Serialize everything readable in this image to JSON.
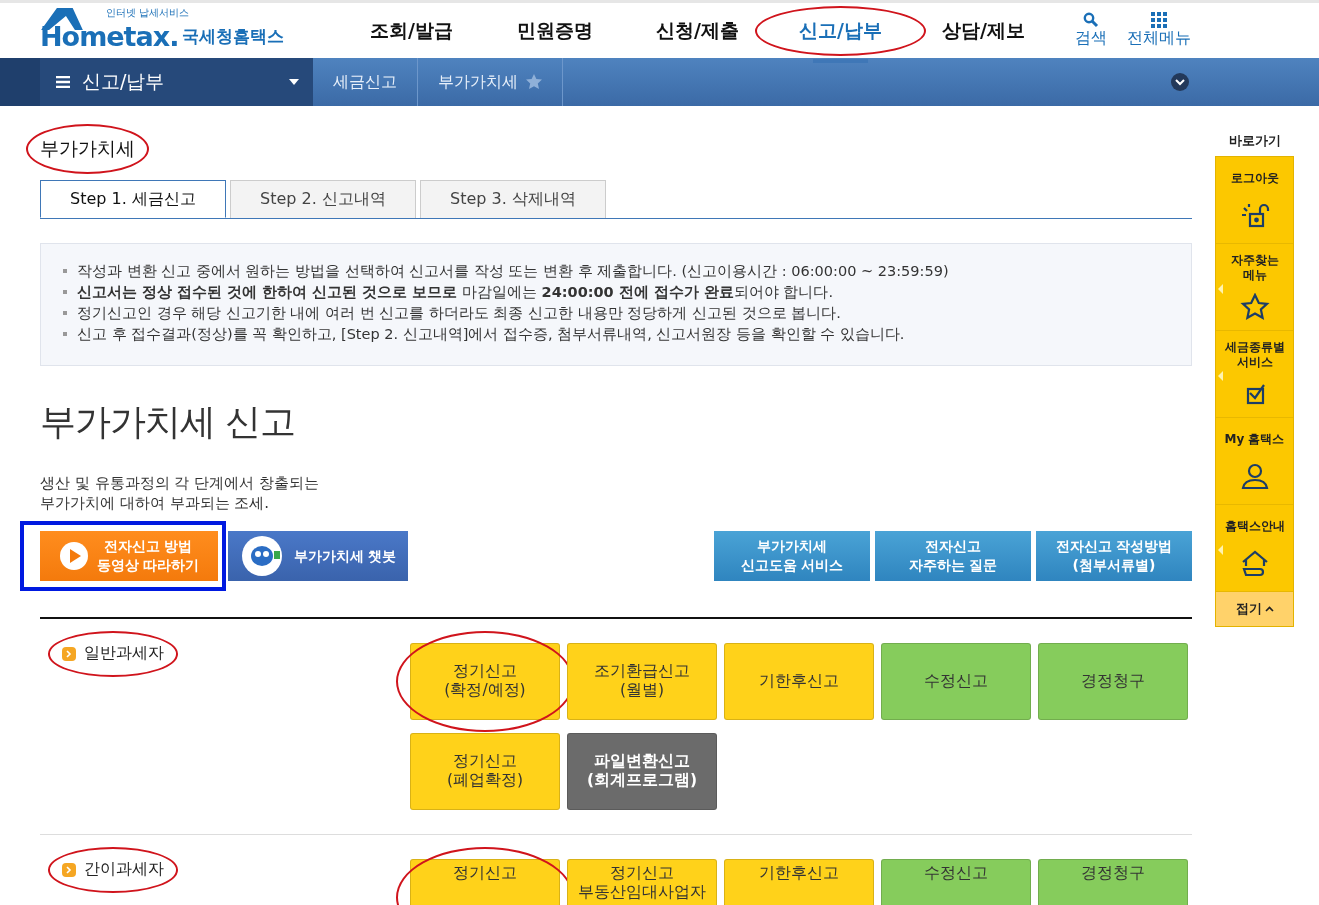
{
  "header": {
    "logo": {
      "tagline": "인터넷 납세서비스",
      "brand": "Hometax.",
      "name": "국세청홈택스"
    },
    "menu": [
      {
        "label": "조회/발급",
        "selected": false,
        "circled": false
      },
      {
        "label": "민원증명",
        "selected": false,
        "circled": false
      },
      {
        "label": "신청/제출",
        "selected": false,
        "circled": false
      },
      {
        "label": "신고/납부",
        "selected": true,
        "circled": true
      },
      {
        "label": "상담/제보",
        "selected": false,
        "circled": false
      }
    ],
    "tools": [
      {
        "label": "검색",
        "kind": "search"
      },
      {
        "label": "전체메뉴",
        "kind": "grid"
      }
    ]
  },
  "breadcrumb": {
    "menu_label": "신고/납부",
    "items": [
      "세금신고",
      "부가가치세"
    ],
    "favorite": false
  },
  "page_title": {
    "text": "부가가치세",
    "circled": true
  },
  "tabs": [
    {
      "label": "Step 1. 세금신고",
      "selected": true
    },
    {
      "label": "Step 2. 신고내역",
      "selected": false
    },
    {
      "label": "Step 3. 삭제내역",
      "selected": false
    }
  ],
  "notices": [
    "작성과 변환 신고 중에서 원하는 방법을 선택하여 신고서를 작성 또는 변환 후 제출합니다. (신고이용시간 : 06:00:00 ~ 23:59:59)",
    "**신고서는 정상 접수된 것에 한하여 신고된 것으로 보므로** 마감일에는 **24:00:00 전에 접수가 완료**되어야 합니다.",
    "정기신고인 경우 해당 신고기한 내에 여러 번 신고를 하더라도 최종 신고한 내용만 정당하게 신고된 것으로 봅니다.",
    "신고 후 접수결과(정상)를 꼭 확인하고, [Step 2. 신고내역]에서 접수증, 첨부서류내역, 신고서원장 등을 확인할 수 있습니다."
  ],
  "section": {
    "title": "부가가치세 신고",
    "description": [
      "생산 및 유통과정의 각 단계에서 창출되는",
      "부가가치에 대하여 부과되는 조세."
    ]
  },
  "action_buttons": [
    {
      "kind": "video",
      "lines": [
        "전자신고 방법",
        "동영상 따라하기"
      ],
      "boxed": true
    },
    {
      "kind": "chatbot",
      "lines": [
        "부가가치세 챗봇"
      ],
      "boxed": false
    },
    {
      "kind": "link",
      "lines": [
        "부가가치세",
        "신고도움 서비스"
      ],
      "boxed": false
    },
    {
      "kind": "link",
      "lines": [
        "전자신고",
        "자주하는 질문"
      ],
      "boxed": false
    },
    {
      "kind": "link",
      "lines": [
        "전자신고 작성방법",
        "(첨부서류별)"
      ],
      "boxed": false
    }
  ],
  "taxpayer_groups": [
    {
      "label": "일반과세자",
      "circled": true,
      "buttons": [
        {
          "lines": [
            "정기신고",
            "(확정/예정)"
          ],
          "color": "#ffd21a",
          "circled": true
        },
        {
          "lines": [
            "조기환급신고",
            "(월별)"
          ],
          "color": "#ffd21a",
          "circled": false
        },
        {
          "lines": [
            "기한후신고"
          ],
          "color": "#ffd21a",
          "circled": false
        },
        {
          "lines": [
            "수정신고"
          ],
          "color": "#86cc5c",
          "circled": false
        },
        {
          "lines": [
            "경정청구"
          ],
          "color": "#86cc5c",
          "circled": false
        },
        {
          "lines": [
            "정기신고",
            "(폐업확정)"
          ],
          "color": "#ffd21a",
          "circled": false
        },
        {
          "lines": [
            "파일변환신고",
            "(회계프로그램)"
          ],
          "color": "#6b6b6b",
          "circled": false
        }
      ]
    },
    {
      "label": "간이과세자",
      "circled": true,
      "buttons": [
        {
          "lines": [
            "정기신고"
          ],
          "color": "#ffd21a",
          "circled": true
        },
        {
          "lines": [
            "정기신고",
            "부동산임대사업자"
          ],
          "color": "#ffd21a",
          "circled": false
        },
        {
          "lines": [
            "기한후신고"
          ],
          "color": "#ffd21a",
          "circled": false
        },
        {
          "lines": [
            "수정신고"
          ],
          "color": "#86cc5c",
          "circled": false
        },
        {
          "lines": [
            "경정청구"
          ],
          "color": "#86cc5c",
          "circled": false
        }
      ]
    }
  ],
  "quick_menu": {
    "title": "바로가기",
    "items": [
      {
        "lines": [
          "로그아웃"
        ],
        "kind": "unlock",
        "flyout": false
      },
      {
        "lines": [
          "자주찾는",
          "메뉴"
        ],
        "kind": "star",
        "flyout": true
      },
      {
        "lines": [
          "세금종류별",
          "서비스"
        ],
        "kind": "check",
        "flyout": true
      },
      {
        "lines": [
          "My 홈택스"
        ],
        "kind": "person",
        "flyout": false
      },
      {
        "lines": [
          "홈택스안내"
        ],
        "kind": "house",
        "flyout": true
      }
    ],
    "collapse": "접기"
  }
}
